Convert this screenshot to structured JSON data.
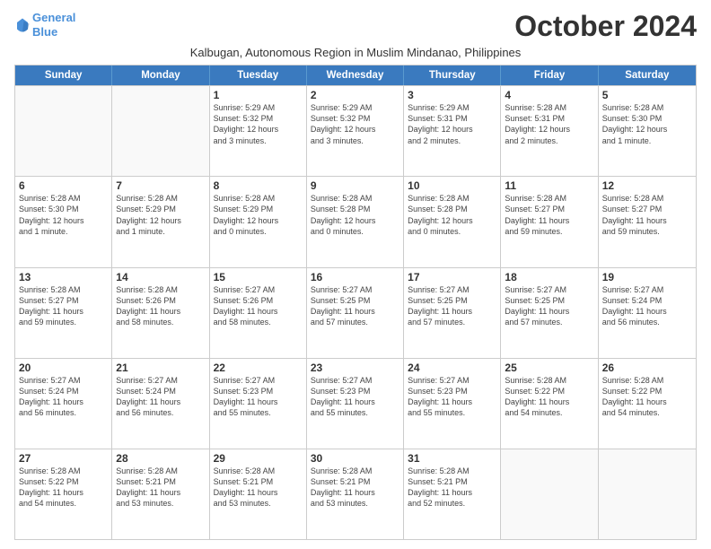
{
  "logo": {
    "line1": "General",
    "line2": "Blue"
  },
  "title": "October 2024",
  "subtitle": "Kalbugan, Autonomous Region in Muslim Mindanao, Philippines",
  "headers": [
    "Sunday",
    "Monday",
    "Tuesday",
    "Wednesday",
    "Thursday",
    "Friday",
    "Saturday"
  ],
  "weeks": [
    [
      {
        "day": "",
        "text": ""
      },
      {
        "day": "",
        "text": ""
      },
      {
        "day": "1",
        "text": "Sunrise: 5:29 AM\nSunset: 5:32 PM\nDaylight: 12 hours\nand 3 minutes."
      },
      {
        "day": "2",
        "text": "Sunrise: 5:29 AM\nSunset: 5:32 PM\nDaylight: 12 hours\nand 3 minutes."
      },
      {
        "day": "3",
        "text": "Sunrise: 5:29 AM\nSunset: 5:31 PM\nDaylight: 12 hours\nand 2 minutes."
      },
      {
        "day": "4",
        "text": "Sunrise: 5:28 AM\nSunset: 5:31 PM\nDaylight: 12 hours\nand 2 minutes."
      },
      {
        "day": "5",
        "text": "Sunrise: 5:28 AM\nSunset: 5:30 PM\nDaylight: 12 hours\nand 1 minute."
      }
    ],
    [
      {
        "day": "6",
        "text": "Sunrise: 5:28 AM\nSunset: 5:30 PM\nDaylight: 12 hours\nand 1 minute."
      },
      {
        "day": "7",
        "text": "Sunrise: 5:28 AM\nSunset: 5:29 PM\nDaylight: 12 hours\nand 1 minute."
      },
      {
        "day": "8",
        "text": "Sunrise: 5:28 AM\nSunset: 5:29 PM\nDaylight: 12 hours\nand 0 minutes."
      },
      {
        "day": "9",
        "text": "Sunrise: 5:28 AM\nSunset: 5:28 PM\nDaylight: 12 hours\nand 0 minutes."
      },
      {
        "day": "10",
        "text": "Sunrise: 5:28 AM\nSunset: 5:28 PM\nDaylight: 12 hours\nand 0 minutes."
      },
      {
        "day": "11",
        "text": "Sunrise: 5:28 AM\nSunset: 5:27 PM\nDaylight: 11 hours\nand 59 minutes."
      },
      {
        "day": "12",
        "text": "Sunrise: 5:28 AM\nSunset: 5:27 PM\nDaylight: 11 hours\nand 59 minutes."
      }
    ],
    [
      {
        "day": "13",
        "text": "Sunrise: 5:28 AM\nSunset: 5:27 PM\nDaylight: 11 hours\nand 59 minutes."
      },
      {
        "day": "14",
        "text": "Sunrise: 5:28 AM\nSunset: 5:26 PM\nDaylight: 11 hours\nand 58 minutes."
      },
      {
        "day": "15",
        "text": "Sunrise: 5:27 AM\nSunset: 5:26 PM\nDaylight: 11 hours\nand 58 minutes."
      },
      {
        "day": "16",
        "text": "Sunrise: 5:27 AM\nSunset: 5:25 PM\nDaylight: 11 hours\nand 57 minutes."
      },
      {
        "day": "17",
        "text": "Sunrise: 5:27 AM\nSunset: 5:25 PM\nDaylight: 11 hours\nand 57 minutes."
      },
      {
        "day": "18",
        "text": "Sunrise: 5:27 AM\nSunset: 5:25 PM\nDaylight: 11 hours\nand 57 minutes."
      },
      {
        "day": "19",
        "text": "Sunrise: 5:27 AM\nSunset: 5:24 PM\nDaylight: 11 hours\nand 56 minutes."
      }
    ],
    [
      {
        "day": "20",
        "text": "Sunrise: 5:27 AM\nSunset: 5:24 PM\nDaylight: 11 hours\nand 56 minutes."
      },
      {
        "day": "21",
        "text": "Sunrise: 5:27 AM\nSunset: 5:24 PM\nDaylight: 11 hours\nand 56 minutes."
      },
      {
        "day": "22",
        "text": "Sunrise: 5:27 AM\nSunset: 5:23 PM\nDaylight: 11 hours\nand 55 minutes."
      },
      {
        "day": "23",
        "text": "Sunrise: 5:27 AM\nSunset: 5:23 PM\nDaylight: 11 hours\nand 55 minutes."
      },
      {
        "day": "24",
        "text": "Sunrise: 5:27 AM\nSunset: 5:23 PM\nDaylight: 11 hours\nand 55 minutes."
      },
      {
        "day": "25",
        "text": "Sunrise: 5:28 AM\nSunset: 5:22 PM\nDaylight: 11 hours\nand 54 minutes."
      },
      {
        "day": "26",
        "text": "Sunrise: 5:28 AM\nSunset: 5:22 PM\nDaylight: 11 hours\nand 54 minutes."
      }
    ],
    [
      {
        "day": "27",
        "text": "Sunrise: 5:28 AM\nSunset: 5:22 PM\nDaylight: 11 hours\nand 54 minutes."
      },
      {
        "day": "28",
        "text": "Sunrise: 5:28 AM\nSunset: 5:21 PM\nDaylight: 11 hours\nand 53 minutes."
      },
      {
        "day": "29",
        "text": "Sunrise: 5:28 AM\nSunset: 5:21 PM\nDaylight: 11 hours\nand 53 minutes."
      },
      {
        "day": "30",
        "text": "Sunrise: 5:28 AM\nSunset: 5:21 PM\nDaylight: 11 hours\nand 53 minutes."
      },
      {
        "day": "31",
        "text": "Sunrise: 5:28 AM\nSunset: 5:21 PM\nDaylight: 11 hours\nand 52 minutes."
      },
      {
        "day": "",
        "text": ""
      },
      {
        "day": "",
        "text": ""
      }
    ]
  ]
}
